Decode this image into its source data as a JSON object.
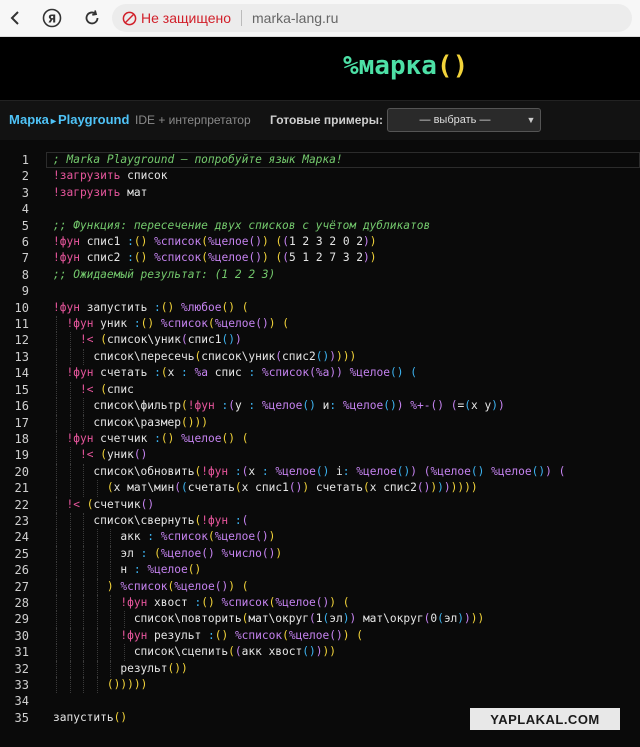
{
  "browser": {
    "security_text": "Не защищено",
    "url": "marka-lang.ru",
    "nav_icons": [
      "back-arrow-icon",
      "yandex-icon",
      "reload-icon"
    ]
  },
  "header": {
    "logo_main": "%марка",
    "logo_parens": "()"
  },
  "toolbar": {
    "brand_a": "Марка",
    "brand_arrow": "▸",
    "brand_b": "Playground",
    "subtitle": "IDE + интерпретатор",
    "examples_label": "Готовые примеры:",
    "examples_selected": "— выбрать —"
  },
  "editor": {
    "line_numbers": [
      "1",
      "2",
      "3",
      "4",
      "5",
      "6",
      "7",
      "8",
      "9",
      "10",
      "11",
      "12",
      "13",
      "14",
      "15",
      "16",
      "17",
      "18",
      "19",
      "20",
      "21",
      "22",
      "23",
      "24",
      "25",
      "26",
      "27",
      "28",
      "29",
      "30",
      "31",
      "32",
      "33",
      "34",
      "35"
    ],
    "lines": [
      "; Marka Playground — попробуйте язык Марка!",
      "!загрузить список",
      "!загрузить мат",
      "",
      ";; Функция: пересечение двух списков с учётом дубликатов",
      "!фун спис1 :() %список(%целое()) ((1 2 3 2 0 2))",
      "!фун спис2 :() %список(%целое()) ((5 1 2 7 3 2))",
      ";; Ожидаемый результат: (1 2 2 3)",
      "",
      "!фун запустить :() %любое() (",
      "  !фун уник :() %список(%целое()) (",
      "    !< (список\\уник(спис1())",
      "      список\\пересечь(список\\уник(спис2()))))",
      "  !фун счетать :(х : %а спис : %список(%а)) %целое() (",
      "    !< (спис",
      "      список\\фильтр(!фун :(у : %целое() и: %целое()) %+-() (=(х у))",
      "      список\\размер()))",
      "  !фун счетчик :() %целое() (",
      "    !< (уник()",
      "      список\\обновить(!фун :(х : %целое() i: %целое()) (%целое() %целое()) (",
      "        (х мат\\мин((счетать(х спис1()) счетать(х спис2())))))))",
      "  !< (счетчик()",
      "      список\\свернуть(!фун :(",
      "          акк : %список(%целое())",
      "          эл : (%целое() %число())",
      "          н : %целое()",
      "        ) %список(%целое()) (",
      "          !фун хвост :() %список(%целое()) (",
      "            список\\повторить(мат\\округ(1(эл)) мат\\округ(0(эл))))",
      "          !фун результ :() %список(%целое()) (",
      "            список\\сцепить((акк хвост())))",
      "          результ())",
      "        ()))))",
      "",
      "запустить()"
    ]
  },
  "watermark": "YAPLAKAL.COM"
}
